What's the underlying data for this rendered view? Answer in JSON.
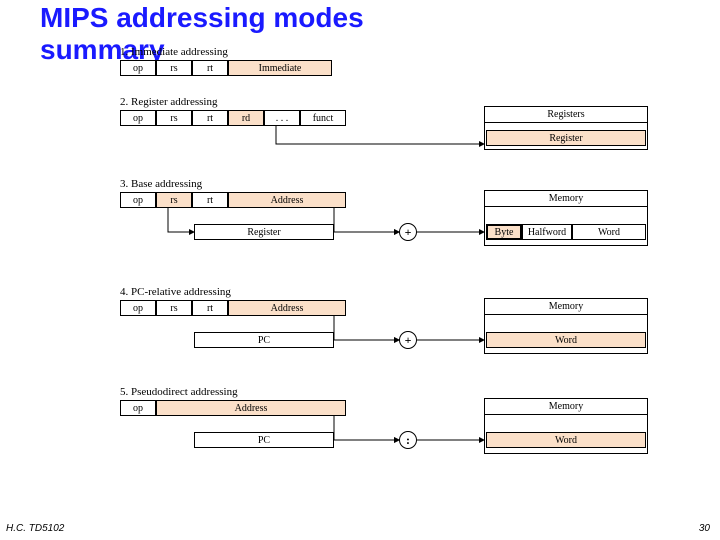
{
  "title_l1": "MIPS addressing modes",
  "title_l2": "summary",
  "footer_left": "H.C. TD5102",
  "footer_right": "30",
  "m1": {
    "head": "1. Immediate addressing",
    "op": "op",
    "rs": "rs",
    "rt": "rt",
    "imm": "Immediate"
  },
  "m2": {
    "head": "2. Register addressing",
    "op": "op",
    "rs": "rs",
    "rt": "rt",
    "rd": "rd",
    "dots": ". . .",
    "funct": "funct",
    "registers": "Registers",
    "register": "Register"
  },
  "m3": {
    "head": "3. Base addressing",
    "op": "op",
    "rs": "rs",
    "rt": "rt",
    "addr": "Address",
    "register": "Register",
    "plus": "+",
    "memory": "Memory",
    "byte": "Byte",
    "half": "Halfword",
    "word": "Word"
  },
  "m4": {
    "head": "4. PC-relative addressing",
    "op": "op",
    "rs": "rs",
    "rt": "rt",
    "addr": "Address",
    "pc": "PC",
    "plus": "+",
    "memory": "Memory",
    "word": "Word"
  },
  "m5": {
    "head": "5. Pseudodirect addressing",
    "op": "op",
    "addr": "Address",
    "pc": "PC",
    "concat": ":",
    "memory": "Memory",
    "word": "Word"
  }
}
